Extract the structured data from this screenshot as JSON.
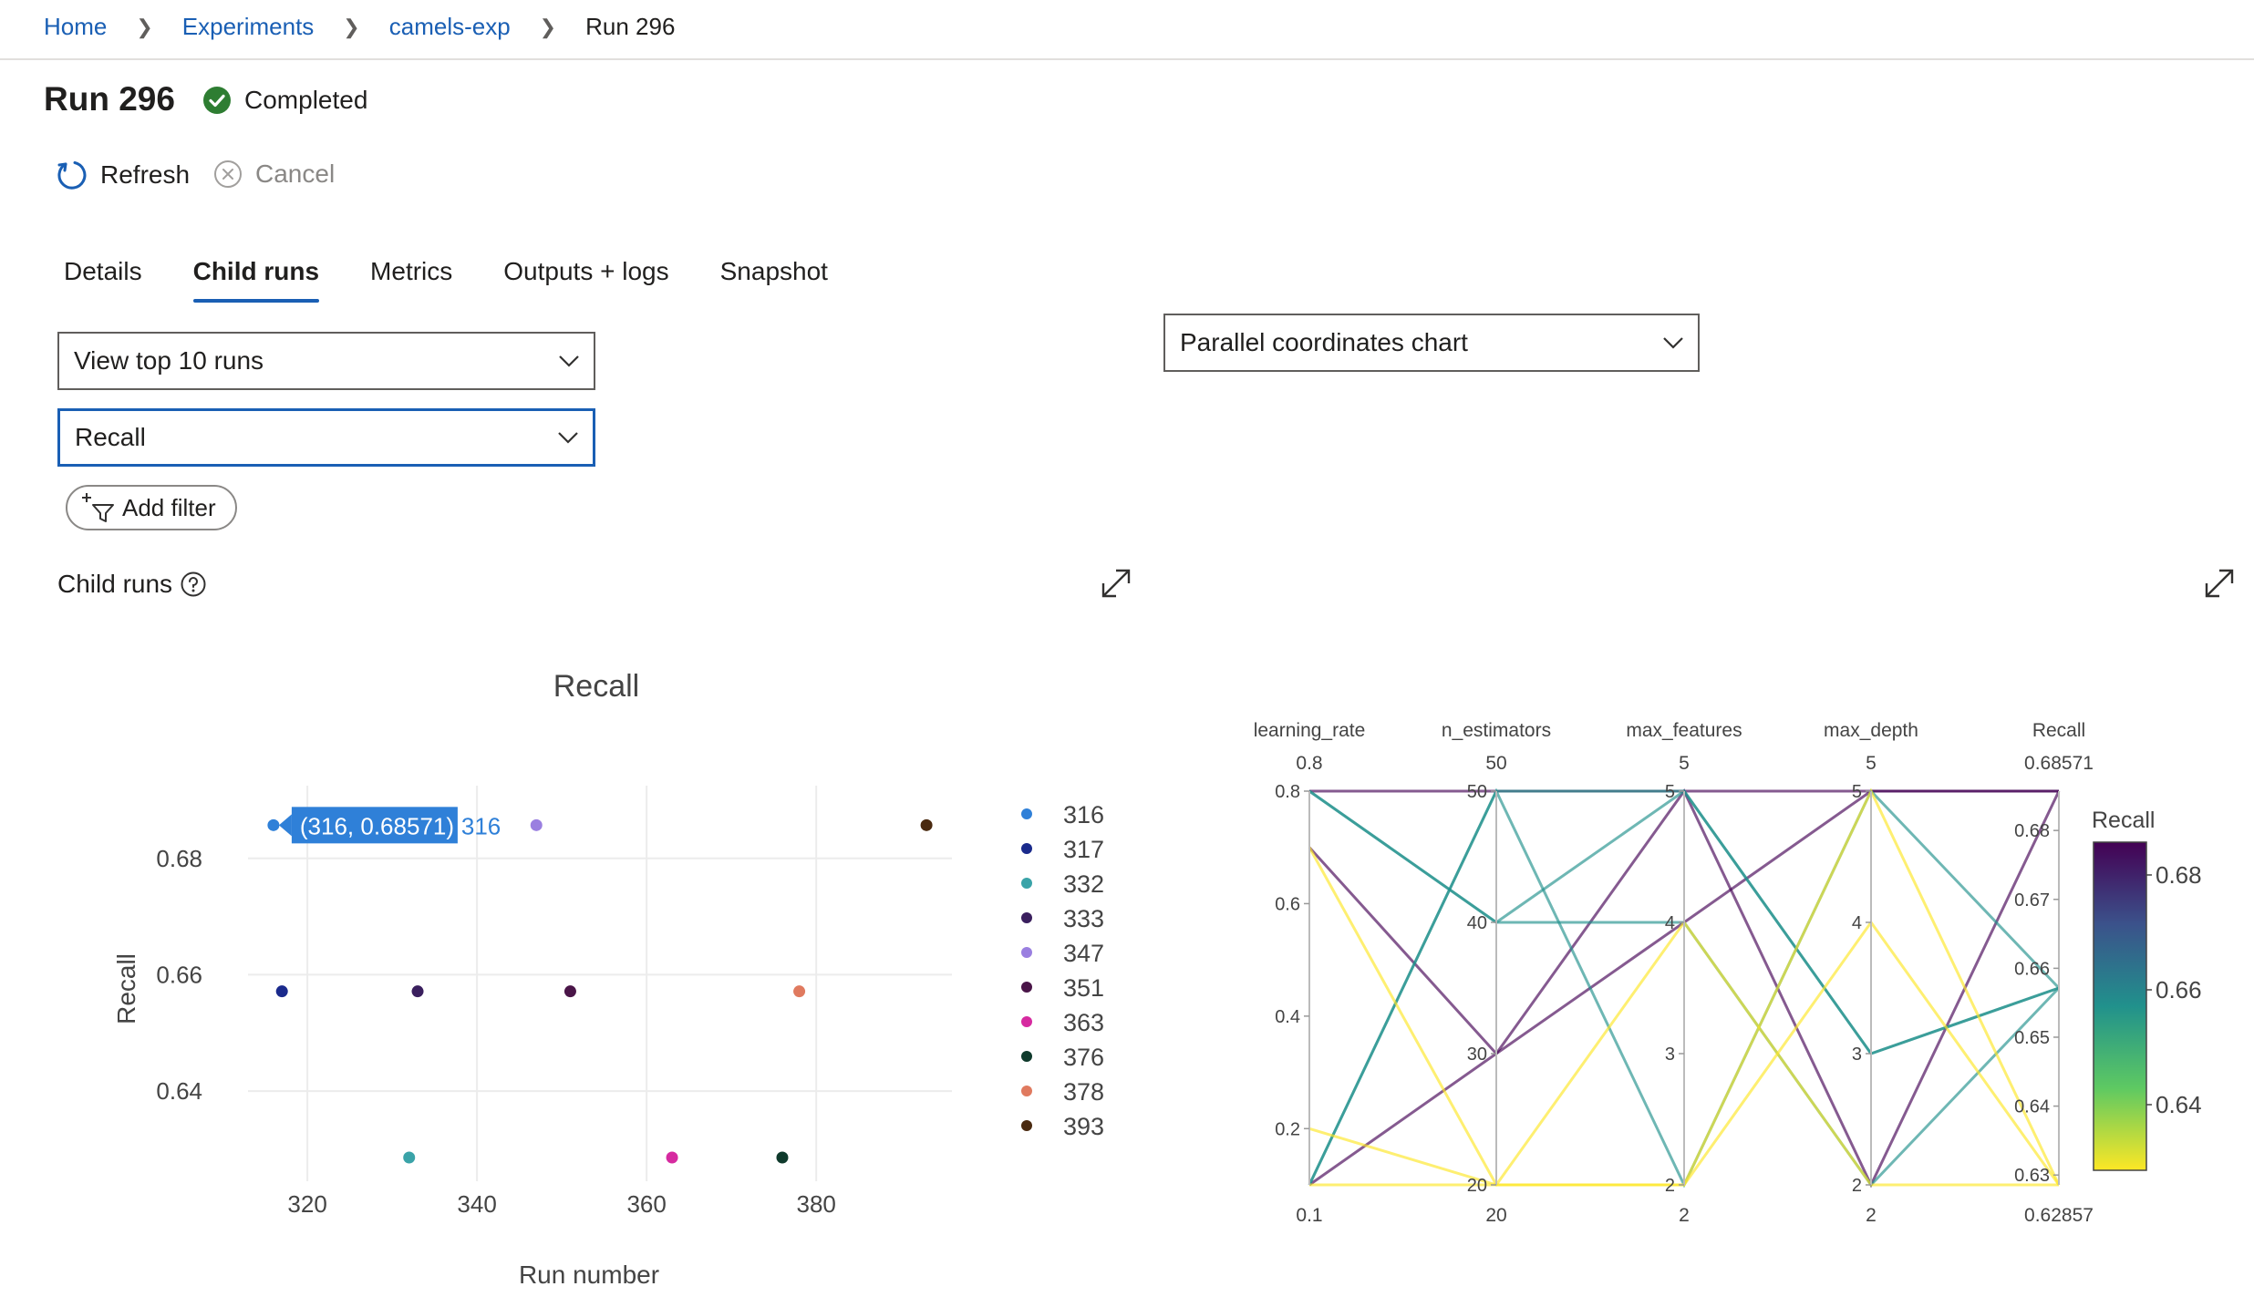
{
  "breadcrumb": {
    "home": "Home",
    "experiments": "Experiments",
    "experiment": "camels-exp",
    "current": "Run 296"
  },
  "run": {
    "title": "Run 296",
    "status": "Completed"
  },
  "commands": {
    "refresh": "Refresh",
    "cancel": "Cancel"
  },
  "tabs": [
    "Details",
    "Child runs",
    "Metrics",
    "Outputs + logs",
    "Snapshot"
  ],
  "active_tab": "Child runs",
  "controls": {
    "top_runs": "View top 10 runs",
    "metric": "Recall",
    "add_filter": "Add filter",
    "chart_type": "Parallel coordinates chart",
    "section_title": "Child runs"
  },
  "colors": {
    "accent": "#1a5fb4",
    "success": "#2e7d32"
  },
  "icons": {
    "status": "check-circle-icon",
    "refresh": "refresh-icon",
    "cancel": "cancel-icon",
    "expand": "expand-icon",
    "help": "help-icon",
    "filter": "filter-add-icon"
  },
  "chart_data": [
    {
      "type": "scatter",
      "title": "Recall",
      "xlabel": "Run number",
      "ylabel": "Recall",
      "xticks": [
        "320",
        "340",
        "360",
        "380"
      ],
      "yticks": [
        "0.64",
        "0.66",
        "0.68"
      ],
      "xlim": [
        313,
        396
      ],
      "ylim": [
        0.6245,
        0.6925
      ],
      "tooltip": {
        "text": "(316, 0.68571)",
        "series": "316"
      },
      "series": [
        {
          "name": "316",
          "x": 316,
          "y": 0.68571,
          "color": "#2f80d8"
        },
        {
          "name": "317",
          "x": 317,
          "y": 0.65714,
          "color": "#1a2a8c"
        },
        {
          "name": "332",
          "x": 332,
          "y": 0.62857,
          "color": "#3aa3a8"
        },
        {
          "name": "333",
          "x": 333,
          "y": 0.65714,
          "color": "#3a1f5e"
        },
        {
          "name": "347",
          "x": 347,
          "y": 0.68571,
          "color": "#9a7fe0"
        },
        {
          "name": "351",
          "x": 351,
          "y": 0.65714,
          "color": "#4a1548"
        },
        {
          "name": "363",
          "x": 363,
          "y": 0.62857,
          "color": "#d62aa0"
        },
        {
          "name": "376",
          "x": 376,
          "y": 0.62857,
          "color": "#0f3a2c"
        },
        {
          "name": "378",
          "x": 378,
          "y": 0.65714,
          "color": "#e07a5f"
        },
        {
          "name": "393",
          "x": 393,
          "y": 0.68571,
          "color": "#4a2a10"
        }
      ]
    },
    {
      "type": "parallel_coordinates",
      "colorbar": {
        "title": "Recall",
        "ticks": [
          "0.64",
          "0.66",
          "0.68"
        ],
        "range": [
          0.62857,
          0.68571
        ]
      },
      "dimensions": [
        {
          "name": "learning_rate",
          "range": [
            0.1,
            0.8
          ],
          "min_label": "0.1",
          "max_label": "0.8",
          "ticks": [
            "0.2",
            "0.4",
            "0.6",
            "0.8"
          ]
        },
        {
          "name": "n_estimators",
          "range": [
            20,
            50
          ],
          "min_label": "20",
          "max_label": "50",
          "ticks": [
            "20",
            "30",
            "40",
            "50"
          ]
        },
        {
          "name": "max_features",
          "range": [
            2,
            5
          ],
          "min_label": "2",
          "max_label": "5",
          "ticks": [
            "2",
            "3",
            "4",
            "5"
          ]
        },
        {
          "name": "max_depth",
          "range": [
            2,
            5
          ],
          "min_label": "2",
          "max_label": "5",
          "ticks": [
            "2",
            "3",
            "4",
            "5"
          ]
        },
        {
          "name": "Recall",
          "range": [
            0.62857,
            0.68571
          ],
          "min_label": "0.62857",
          "max_label": "0.68571",
          "ticks": [
            "0.63",
            "0.64",
            "0.65",
            "0.66",
            "0.67",
            "0.68"
          ]
        }
      ],
      "lines": [
        [
          0.8,
          50,
          5,
          5,
          0.68571
        ],
        [
          0.7,
          30,
          5,
          2,
          0.68571
        ],
        [
          0.1,
          30,
          4,
          5,
          0.68571
        ],
        [
          0.1,
          50,
          5,
          3,
          0.65714
        ],
        [
          0.8,
          40,
          4,
          2,
          0.65714
        ],
        [
          0.1,
          50,
          2,
          5,
          0.65714
        ],
        [
          0.8,
          40,
          5,
          3,
          0.65714
        ],
        [
          0.7,
          20,
          2,
          4,
          0.62857
        ],
        [
          0.2,
          20,
          4,
          2,
          0.62857
        ],
        [
          0.1,
          20,
          2,
          5,
          0.62857
        ]
      ]
    }
  ]
}
